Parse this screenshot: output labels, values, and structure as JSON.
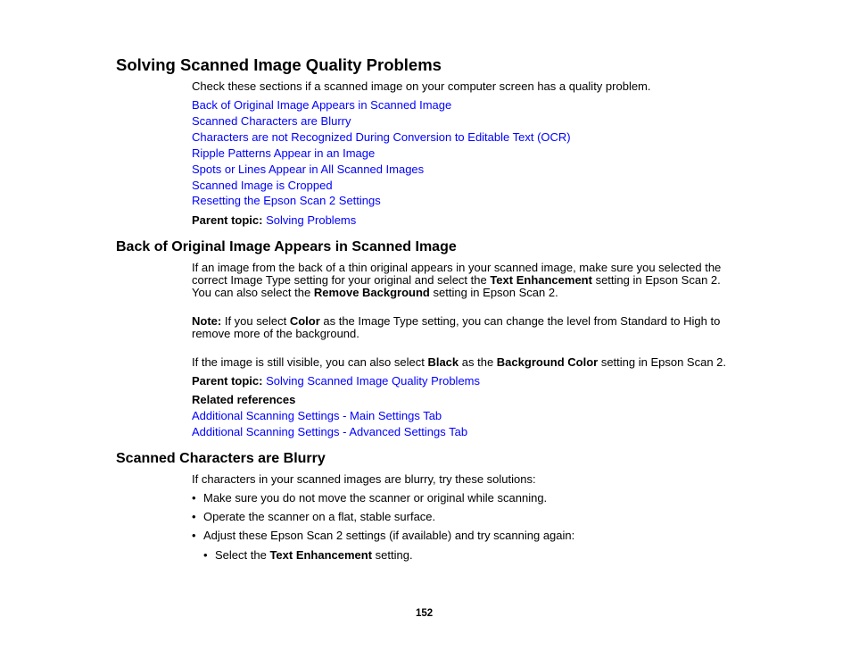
{
  "section1": {
    "title": "Solving Scanned Image Quality Problems",
    "intro": "Check these sections if a scanned image on your computer screen has a quality problem.",
    "links": [
      "Back of Original Image Appears in Scanned Image",
      "Scanned Characters are Blurry",
      "Characters are not Recognized During Conversion to Editable Text (OCR)",
      "Ripple Patterns Appear in an Image",
      "Spots or Lines Appear in All Scanned Images",
      "Scanned Image is Cropped",
      "Resetting the Epson Scan 2 Settings"
    ],
    "parent_label": "Parent topic:",
    "parent_link": "Solving Problems"
  },
  "section2": {
    "title": "Back of Original Image Appears in Scanned Image",
    "para1": {
      "line1": "If an image from the back of a thin original appears in your scanned image, make sure you selected the",
      "line2_a": "correct Image Type setting for your original and select the ",
      "line2_b": "Text Enhancement",
      "line2_c": " setting in Epson Scan 2.",
      "line3_a": "You can also select the ",
      "line3_b": "Remove Background",
      "line3_c": " setting in Epson Scan 2."
    },
    "note": {
      "label": "Note:",
      "a": " If you select ",
      "b": "Color",
      "c": " as the Image Type setting, you can change the level from Standard to High to",
      "line2": "remove more of the background."
    },
    "para2": {
      "a": "If the image is still visible, you can also select ",
      "b": "Black",
      "c": " as the ",
      "d": "Background Color",
      "e": " setting in Epson Scan 2."
    },
    "parent_label": "Parent topic:",
    "parent_link": "Solving Scanned Image Quality Problems",
    "related_label": "Related references",
    "related_links": [
      "Additional Scanning Settings - Main Settings Tab",
      "Additional Scanning Settings - Advanced Settings Tab"
    ]
  },
  "section3": {
    "title": "Scanned Characters are Blurry",
    "intro": "If characters in your scanned images are blurry, try these solutions:",
    "bullets": [
      "Make sure you do not move the scanner or original while scanning.",
      "Operate the scanner on a flat, stable surface.",
      "Adjust these Epson Scan 2 settings (if available) and try scanning again:"
    ],
    "sub_bullet": {
      "a": "Select the ",
      "b": "Text Enhancement",
      "c": " setting."
    },
    "bullet_glyph": "•"
  },
  "page_number": "152"
}
